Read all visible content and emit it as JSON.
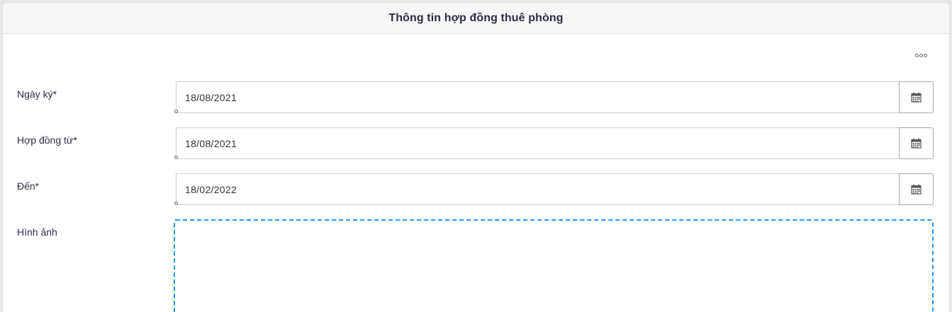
{
  "header": {
    "title": "Thông tin hợp đồng thuê phòng"
  },
  "more_menu": {
    "icon": "more-horizontal-icon"
  },
  "fields": {
    "sign_date": {
      "label": "Ngày ký*",
      "value": "18/08/2021",
      "icon": "calendar-icon"
    },
    "contract_from": {
      "label": "Hợp đồng từ*",
      "value": "18/08/2021",
      "icon": "calendar-icon"
    },
    "contract_to": {
      "label": "Đến*",
      "value": "18/02/2022",
      "icon": "calendar-icon"
    },
    "images": {
      "label": "Hình ảnh"
    }
  },
  "colors": {
    "upload_border": "#2196f3",
    "title_text": "#2b2d42"
  }
}
